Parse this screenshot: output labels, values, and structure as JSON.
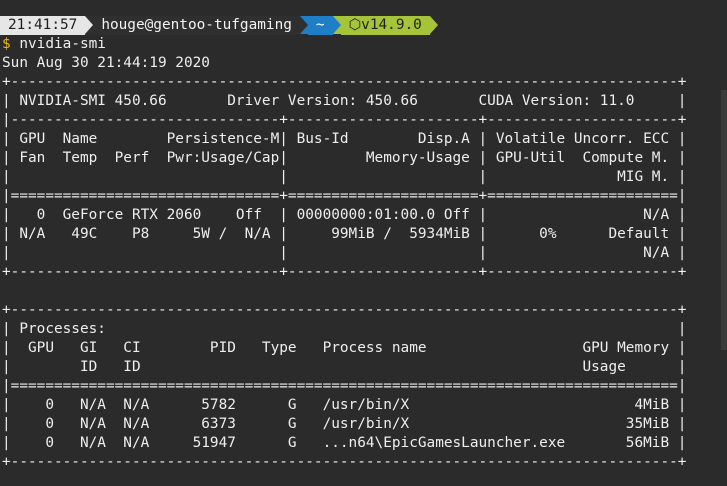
{
  "prompt": {
    "time": "21:41:57",
    "user_host": "houge@gentoo-tufgaming",
    "dir": "~",
    "node_icon": "⬡",
    "node_version": "v14.9.0"
  },
  "command": {
    "symbol": "$",
    "text": " nvidia-smi"
  },
  "output_lines": [
    "Sun Aug 30 21:44:19 2020",
    "+-----------------------------------------------------------------------------+",
    "| NVIDIA-SMI 450.66       Driver Version: 450.66       CUDA Version: 11.0     |",
    "|-------------------------------+----------------------+----------------------+",
    "| GPU  Name        Persistence-M| Bus-Id        Disp.A | Volatile Uncorr. ECC |",
    "| Fan  Temp  Perf  Pwr:Usage/Cap|         Memory-Usage | GPU-Util  Compute M. |",
    "|                               |                      |               MIG M. |",
    "|===============================+======================+======================|",
    "|   0  GeForce RTX 2060    Off  | 00000000:01:00.0 Off |                  N/A |",
    "| N/A   49C    P8     5W /  N/A |     99MiB /  5934MiB |      0%      Default |",
    "|                               |                      |                  N/A |",
    "+-------------------------------+----------------------+----------------------+",
    "",
    "+-----------------------------------------------------------------------------+",
    "| Processes:                                                                  |",
    "|  GPU   GI   CI        PID   Type   Process name                  GPU Memory |",
    "|        ID   ID                                                   Usage      |",
    "|=============================================================================|",
    "|    0   N/A  N/A      5782      G   /usr/bin/X                          4MiB |",
    "|    0   N/A  N/A      6373      G   /usr/bin/X                         35MiB |",
    "|    0   N/A  N/A     51947      G   ...n64\\EpicGamesLauncher.exe       56MiB |",
    "+-----------------------------------------------------------------------------+"
  ]
}
